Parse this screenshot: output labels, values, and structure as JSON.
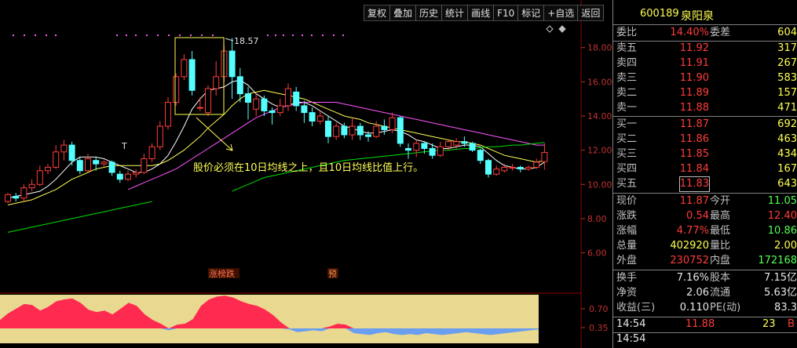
{
  "toolbar": {
    "items": [
      "复权",
      "叠加",
      "历史",
      "统计",
      "画线",
      "F10",
      "标记",
      "+自选",
      "返回"
    ]
  },
  "stock": {
    "code": "600189",
    "name": "泉阳泉"
  },
  "quote": {
    "weibi_label": "委比",
    "weibi": "14.40%",
    "weicha_label": "委差",
    "weicha": "604",
    "asks": [
      {
        "label": "卖五",
        "price": "11.92",
        "vol": "317"
      },
      {
        "label": "卖四",
        "price": "11.91",
        "vol": "267"
      },
      {
        "label": "卖三",
        "price": "11.90",
        "vol": "583"
      },
      {
        "label": "卖二",
        "price": "11.89",
        "vol": "157"
      },
      {
        "label": "卖一",
        "price": "11.88",
        "vol": "471"
      }
    ],
    "bids": [
      {
        "label": "买一",
        "price": "11.87",
        "vol": "692"
      },
      {
        "label": "买二",
        "price": "11.86",
        "vol": "463"
      },
      {
        "label": "买三",
        "price": "11.85",
        "vol": "434"
      },
      {
        "label": "买四",
        "price": "11.84",
        "vol": "167"
      },
      {
        "label": "买五",
        "price": "11.83",
        "vol": "643"
      }
    ],
    "stats": [
      {
        "l1": "现价",
        "v1": "11.87",
        "l2": "今开",
        "v2": "11.05"
      },
      {
        "l1": "涨跌",
        "v1": "0.54",
        "l2": "最高",
        "v2": "12.40"
      },
      {
        "l1": "涨幅",
        "v1": "4.77%",
        "l2": "最低",
        "v2": "10.86"
      },
      {
        "l1": "总量",
        "v1": "402920",
        "l2": "量比",
        "v2": "2.00"
      },
      {
        "l1": "外盘",
        "v1": "230752",
        "l2": "内盘",
        "v2": "172168"
      }
    ],
    "stats2": [
      {
        "l1": "换手",
        "v1": "7.16%",
        "l2": "股本",
        "v2": "7.15亿"
      },
      {
        "l1": "净资",
        "v1": "2.06",
        "l2": "流通",
        "v2": "5.63亿"
      },
      {
        "l1": "收益(三)",
        "v1": "0.110",
        "l2": "PE(动)",
        "v2": "83.3"
      }
    ],
    "ticks": [
      {
        "time": "14:54",
        "price": "11.88",
        "vol": "23",
        "dir": "B"
      },
      {
        "time": "14:54",
        "price": "",
        "vol": "",
        "dir": ""
      }
    ]
  },
  "annotation": {
    "text": "股价必须在10日均线之上，且10日均线比值上行。",
    "high_label": "18.57",
    "markers": [
      "涨榜跌",
      "预"
    ],
    "t_marker": "T"
  },
  "colors": {
    "up": "#ff3c3c",
    "down": "#54ffff",
    "ma5": "#ffffff",
    "ma10": "#ffff54",
    "ma20": "#ff54ff",
    "ma60": "#00e000",
    "indicator_fill": "#e8d890",
    "indicator_red": "#ff2a50",
    "indicator_blue": "#6a9ef0"
  },
  "chart_data": {
    "type": "candlestick",
    "y_ticks": [
      "18.00",
      "16.00",
      "14.00",
      "12.00",
      "10.00",
      "8.00",
      "6.00"
    ],
    "ylim": [
      5.2,
      19.5
    ],
    "indicator_ticks": [
      "0.70",
      "0.35"
    ],
    "candles": [
      [
        9.0,
        9.4,
        8.9,
        9.5
      ],
      [
        9.3,
        9.2,
        9.0,
        9.5
      ],
      [
        9.2,
        9.8,
        9.0,
        10.0
      ],
      [
        9.8,
        10.0,
        9.6,
        10.3
      ],
      [
        10.0,
        10.8,
        9.9,
        11.1
      ],
      [
        10.8,
        11.0,
        10.6,
        11.2
      ],
      [
        11.0,
        11.9,
        10.9,
        12.3
      ],
      [
        11.9,
        12.3,
        11.4,
        12.6
      ],
      [
        12.3,
        11.4,
        11.1,
        12.5
      ],
      [
        11.4,
        10.8,
        10.6,
        11.6
      ],
      [
        10.8,
        11.5,
        10.7,
        11.8
      ],
      [
        11.4,
        11.2,
        10.8,
        11.6
      ],
      [
        11.2,
        11.3,
        11.0,
        11.4
      ],
      [
        11.3,
        10.7,
        10.5,
        11.4
      ],
      [
        10.6,
        10.3,
        10.1,
        10.8
      ],
      [
        10.3,
        10.6,
        10.2,
        10.8
      ],
      [
        10.6,
        10.7,
        10.4,
        10.9
      ],
      [
        10.7,
        11.5,
        10.6,
        11.8
      ],
      [
        11.5,
        12.2,
        11.3,
        12.4
      ],
      [
        12.2,
        13.4,
        12.0,
        13.7
      ],
      [
        13.4,
        14.8,
        13.2,
        15.1
      ],
      [
        14.8,
        16.3,
        14.6,
        16.5
      ],
      [
        16.3,
        17.3,
        16.1,
        17.6
      ],
      [
        17.3,
        15.5,
        15.2,
        17.8
      ],
      [
        14.5,
        14.5,
        14.3,
        15.1
      ],
      [
        14.2,
        15.6,
        14.0,
        15.8
      ],
      [
        15.6,
        16.3,
        15.2,
        17.2
      ],
      [
        16.3,
        17.8,
        16.0,
        18.1
      ],
      [
        17.8,
        16.3,
        15.0,
        18.57
      ],
      [
        16.3,
        15.3,
        14.8,
        16.8
      ],
      [
        15.3,
        14.8,
        13.8,
        15.7
      ],
      [
        14.4,
        15.0,
        14.0,
        15.3
      ],
      [
        15.0,
        14.3,
        14.0,
        15.2
      ],
      [
        14.3,
        14.2,
        13.5,
        14.5
      ],
      [
        14.2,
        14.6,
        14.0,
        15.0
      ],
      [
        14.6,
        15.6,
        14.3,
        15.9
      ],
      [
        15.4,
        14.6,
        14.3,
        15.7
      ],
      [
        14.6,
        14.2,
        13.6,
        14.9
      ],
      [
        14.2,
        13.7,
        13.4,
        14.5
      ],
      [
        13.7,
        14.0,
        13.5,
        14.3
      ],
      [
        13.7,
        12.8,
        12.4,
        14.0
      ],
      [
        12.8,
        13.4,
        12.6,
        13.6
      ],
      [
        13.4,
        12.9,
        12.7,
        13.6
      ],
      [
        12.9,
        13.4,
        12.6,
        13.9
      ],
      [
        13.4,
        12.9,
        12.6,
        13.6
      ],
      [
        12.9,
        12.8,
        12.5,
        13.1
      ],
      [
        12.8,
        13.4,
        12.7,
        13.7
      ],
      [
        13.4,
        13.2,
        12.9,
        13.8
      ],
      [
        13.2,
        13.9,
        13.0,
        14.2
      ],
      [
        13.9,
        12.4,
        12.2,
        14.0
      ],
      [
        12.1,
        12.0,
        11.5,
        12.4
      ],
      [
        12.0,
        12.4,
        11.6,
        12.6
      ],
      [
        12.4,
        12.1,
        11.8,
        12.5
      ],
      [
        12.1,
        11.7,
        11.5,
        12.4
      ],
      [
        11.7,
        12.2,
        11.6,
        12.5
      ],
      [
        12.2,
        12.5,
        12.0,
        12.6
      ],
      [
        12.3,
        12.5,
        12.1,
        12.7
      ],
      [
        12.5,
        12.4,
        12.2,
        12.8
      ],
      [
        12.4,
        12.0,
        11.9,
        12.5
      ],
      [
        12.0,
        11.4,
        11.2,
        12.1
      ],
      [
        11.4,
        10.6,
        10.4,
        11.5
      ],
      [
        10.6,
        10.9,
        10.5,
        11.1
      ],
      [
        10.8,
        11.0,
        10.7,
        11.2
      ],
      [
        11.0,
        11.0,
        10.8,
        11.2
      ],
      [
        11.0,
        10.9,
        10.7,
        11.1
      ],
      [
        10.9,
        11.0,
        10.8,
        11.1
      ],
      [
        11.0,
        11.3,
        10.9,
        11.5
      ],
      [
        11.33,
        11.87,
        10.86,
        12.4
      ]
    ],
    "ma_series": [
      {
        "name": "MA5",
        "values": [
          9.2,
          9.3,
          9.4,
          9.5,
          9.6,
          9.9,
          10.3,
          10.8,
          11.3,
          11.6,
          11.6,
          11.6,
          11.5,
          11.3,
          11.1,
          10.9,
          10.7,
          10.7,
          10.9,
          11.2,
          11.7,
          12.5,
          13.4,
          14.4,
          15.0,
          15.5,
          15.6,
          15.7,
          16.0,
          16.1,
          15.8,
          15.3,
          15.0,
          14.7,
          14.5,
          14.6,
          14.8,
          14.8,
          14.6,
          14.3,
          14.0,
          13.7,
          13.4,
          13.3,
          13.1,
          13.0,
          13.0,
          13.1,
          13.2,
          13.1,
          12.9,
          12.6,
          12.5,
          12.3,
          12.1,
          12.1,
          12.2,
          12.3,
          12.3,
          12.2,
          11.8,
          11.4,
          11.1,
          11.0,
          10.9,
          10.9,
          11.0,
          11.3
        ]
      },
      {
        "name": "MA10",
        "values": [
          8.8,
          8.9,
          9.0,
          9.1,
          9.3,
          9.5,
          9.7,
          10.0,
          10.3,
          10.5,
          10.7,
          10.9,
          11.0,
          11.1,
          11.1,
          11.1,
          11.1,
          11.1,
          11.1,
          11.2,
          11.4,
          11.7,
          12.0,
          12.4,
          12.8,
          13.3,
          13.7,
          14.1,
          14.6,
          15.0,
          15.3,
          15.4,
          15.5,
          15.4,
          15.3,
          15.2,
          15.1,
          15.0,
          14.8,
          14.6,
          14.4,
          14.2,
          14.0,
          13.9,
          13.8,
          13.6,
          13.5,
          13.4,
          13.3,
          13.2,
          13.1,
          13.0,
          12.9,
          12.8,
          12.7,
          12.6,
          12.5,
          12.5,
          12.4,
          12.3,
          12.1,
          11.9,
          11.7,
          11.6,
          11.5,
          11.4,
          11.3,
          11.4
        ]
      },
      {
        "name": "MA20",
        "values": [
          null,
          null,
          null,
          null,
          null,
          null,
          null,
          null,
          null,
          null,
          null,
          null,
          null,
          null,
          null,
          9.7,
          9.9,
          10.1,
          10.3,
          10.5,
          10.7,
          10.9,
          11.2,
          11.5,
          11.8,
          12.1,
          12.4,
          12.7,
          13.0,
          13.3,
          13.6,
          13.9,
          14.1,
          14.3,
          14.5,
          14.6,
          14.7,
          14.8,
          14.8,
          14.8,
          14.8,
          14.8,
          14.7,
          14.6,
          14.5,
          14.4,
          14.3,
          14.2,
          14.1,
          14.0,
          13.9,
          13.8,
          13.7,
          13.6,
          13.5,
          13.4,
          13.3,
          13.2,
          13.1,
          13.0,
          12.9,
          12.8,
          12.7,
          12.6,
          12.5,
          12.4,
          12.3,
          12.3
        ]
      },
      {
        "name": "MA60",
        "values": [
          7.2,
          7.3,
          7.4,
          7.5,
          7.6,
          7.7,
          7.8,
          7.9,
          8.0,
          8.1,
          8.2,
          8.3,
          8.4,
          8.5,
          8.6,
          8.7,
          8.8,
          8.9,
          9.0,
          null,
          null,
          null,
          null,
          null,
          null,
          null,
          null,
          null,
          9.6,
          9.8,
          10.0,
          10.2,
          10.4,
          10.5,
          10.6,
          10.7,
          10.8,
          10.9,
          11.0,
          11.1,
          11.2,
          11.3,
          11.4,
          11.45,
          11.5,
          11.55,
          11.6,
          11.65,
          11.7,
          11.75,
          11.8,
          11.85,
          11.9,
          11.95,
          12.0,
          12.0,
          12.05,
          12.1,
          12.1,
          12.15,
          12.2,
          12.2,
          12.25,
          12.3,
          12.3,
          12.35,
          12.4,
          12.45
        ]
      }
    ],
    "indicator": [
      0.18,
      0.32,
      0.42,
      0.52,
      0.5,
      0.38,
      0.46,
      0.58,
      0.62,
      0.64,
      0.55,
      0.4,
      0.35,
      0.38,
      0.3,
      0.42,
      0.55,
      0.48,
      0.3,
      0.18,
      0.1,
      -0.04,
      0.08,
      0.1,
      0.2,
      0.48,
      0.62,
      0.68,
      0.7,
      0.66,
      0.58,
      0.52,
      0.48,
      0.4,
      0.28,
      0.12,
      -0.02,
      -0.08,
      -0.06,
      -0.04,
      -0.06,
      0.04,
      0.1,
      0.08,
      -0.1,
      -0.12,
      -0.14,
      -0.1,
      -0.08,
      -0.12,
      -0.14,
      -0.12,
      -0.14,
      -0.1,
      -0.12,
      -0.14,
      -0.12,
      -0.1,
      -0.08,
      -0.1,
      -0.12,
      -0.14,
      -0.12,
      -0.1,
      -0.08,
      -0.06,
      -0.04,
      -0.02
    ]
  }
}
